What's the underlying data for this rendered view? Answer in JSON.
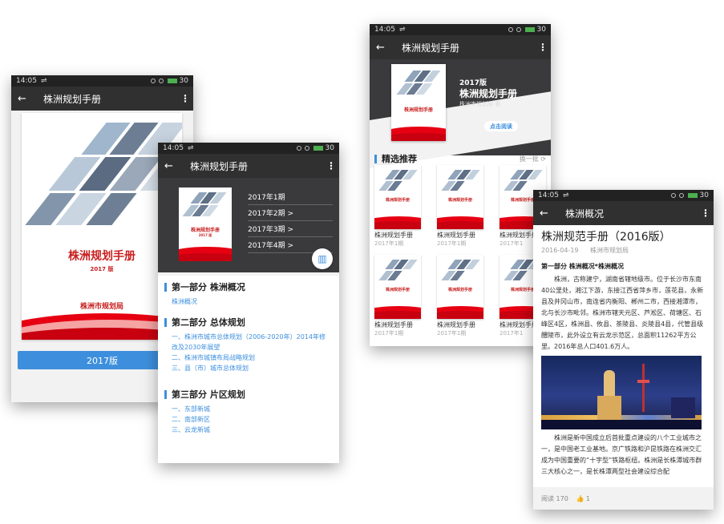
{
  "status": {
    "time": "14:05",
    "battery": "30"
  },
  "p1": {
    "title": "株洲规划手册",
    "cover_title": "株洲规划手册",
    "cover_year": "2017 版",
    "cover_org": "株洲市规划局",
    "button": "2017版"
  },
  "p2": {
    "title": "株洲规划手册",
    "issues": [
      "2017年1期",
      "2017年2期  >",
      "2017年3期  >",
      "2017年4期  >"
    ],
    "cover_title": "株洲规划手册",
    "cover_year": "2017 版",
    "sections": [
      {
        "title": "第一部分 株洲概况",
        "links": [
          "株洲概况"
        ]
      },
      {
        "title": "第二部分 总体规划",
        "links": [
          "一、株洲市城市总体规划（2006-2020年）2014年修",
          "改及2030年展望",
          "二、株洲市城镇布局战略规划",
          "三、县（市）城市总体规划"
        ]
      },
      {
        "title": "第三部分 片区规划",
        "links": [
          "一、东部新城",
          "二、南部新区",
          "三、云龙新城"
        ]
      }
    ]
  },
  "p3": {
    "title": "株洲规划手册",
    "year": "2017版",
    "book_title": "株洲规划手册",
    "author": "株洲市规划局 著",
    "read_button": "点击阅读",
    "recommend": "精选推荐",
    "refresh": "换一批 ⟳",
    "cover_title": "株洲规划手册",
    "items": [
      {
        "title": "株洲规划手册",
        "sub": "2017年1期"
      },
      {
        "title": "株洲规划手册",
        "sub": "2017年1期"
      },
      {
        "title": "株洲规划手册",
        "sub": "2017年1"
      },
      {
        "title": "株洲规划手册",
        "sub": "2017年1期"
      },
      {
        "title": "株洲规划手册",
        "sub": "2017年1期"
      },
      {
        "title": "株洲规划手册",
        "sub": "2017年1"
      }
    ]
  },
  "p4": {
    "title": "株洲概况",
    "article_title": "株洲规范手册（2016版）",
    "date": "2016-04-19",
    "source": "株洲市规划局",
    "heading": "第一部分 株洲概况*株洲概况",
    "para1": "株洲，古称建宁，湖南省辖地级市。位于长沙市东南40公里处，湘江下游，东接江西省萍乡市，莲花县，永新县及井冈山市，南连省内衡阳、郴州二市，西接湘潭市，北与长沙市毗邻。株洲市辖天元区、芦淞区、荷塘区、石峰区4区，株洲县、攸县、茶陵县、炎陵县4县，代管县级醴陵市，此外设立有云龙示范区，总面积11262平方公里。2016年总人口401.6万人。",
    "para2": "株洲是新中国成立后首批重点建设的八个工业城市之一，是中国老工业基地。京广铁路和沪昆铁路在株洲交汇成为中国重要的“十字型”铁路枢纽。株洲是长株潭城市群三大核心之一，是长株潭两型社会建设综合配",
    "reads": "阅读 170",
    "likes": "1"
  }
}
